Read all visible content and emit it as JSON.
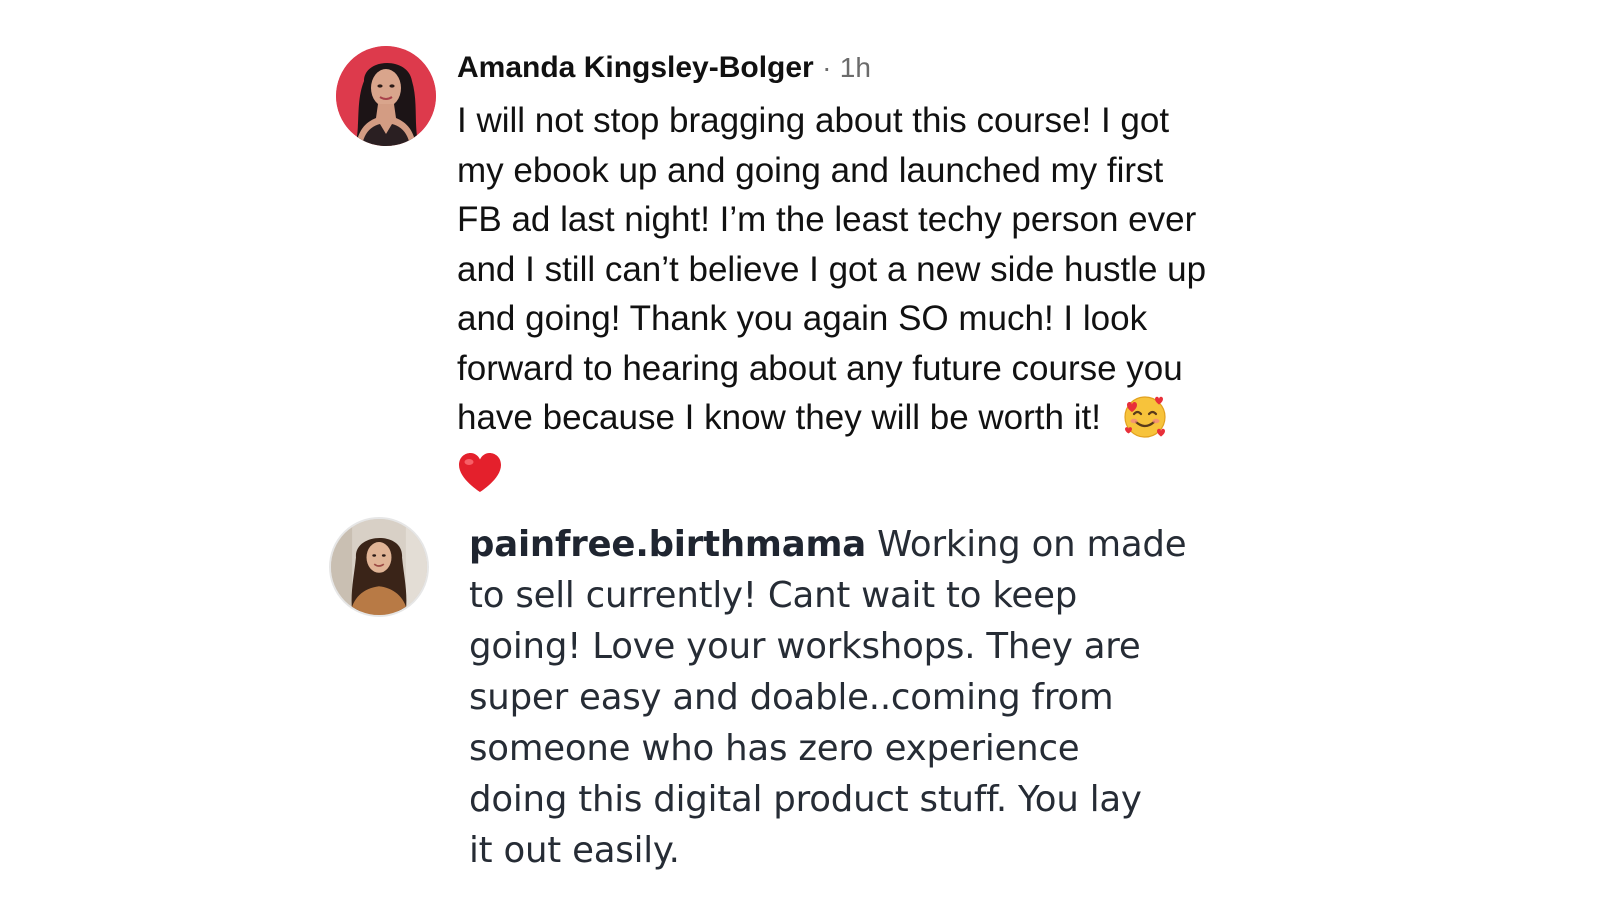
{
  "comment_1": {
    "author": "Amanda Kingsley-Bolger",
    "separator": "·",
    "time": "1h",
    "lines": [
      "I will not stop bragging about this course!  I got",
      "my ebook up and going and launched my first",
      "FB ad last night!  I’m the least techy person ever",
      "and I still can’t believe I got a new side hustle up",
      "and going!  Thank you again SO much!  I look",
      "forward to hearing about any future course you",
      "have because I know they will be worth it!"
    ],
    "emojis": [
      "🥰",
      "❤️"
    ]
  },
  "comment_2": {
    "username": "painfree.birthmama",
    "first_line_text": " Working on made",
    "lines": [
      "to sell currently! Cant wait to keep",
      "going! Love your workshops. They are",
      "super easy and doable..coming from",
      "someone who has zero experience",
      "doing this digital product stuff. You lay",
      "it out easily."
    ]
  },
  "colors": {
    "avatar_1_bg": "#dd3a4c",
    "meta_gray": "#6b6b6b",
    "text_dark": "#111111",
    "text_comment_2": "#262c35"
  }
}
